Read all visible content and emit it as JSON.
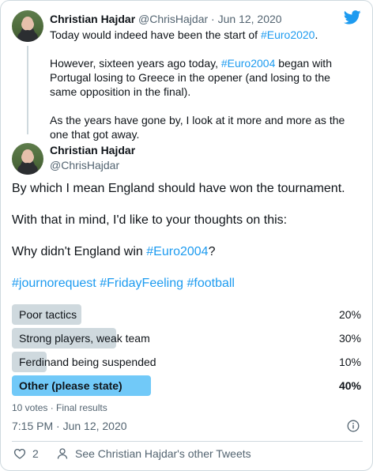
{
  "parent_tweet": {
    "author_name": "Christian Hajdar",
    "handle": "@ChrisHajdar",
    "separator": "·",
    "date": "Jun 12, 2020",
    "line1_prefix": "Today would indeed have been the start of ",
    "line1_hashtag": "#Euro2020",
    "line1_suffix": ".",
    "para2_prefix": "However, sixteen years ago today, ",
    "para2_hashtag": "#Euro2004",
    "para2_suffix": " began with Portugal losing to Greece in the opener (and losing to the same opposition in the final).",
    "para3": "As the years have gone by, I look at it more and more as the one that got away."
  },
  "main_tweet": {
    "author_name": "Christian Hajdar",
    "handle": "@ChrisHajdar",
    "para1": "By which I mean England should have won the tournament.",
    "para2": "With that in mind, I'd like to your thoughts on this:",
    "para3_prefix": "Why didn't England win ",
    "para3_hashtag": "#Euro2004",
    "para3_suffix": "?",
    "hashtags": [
      "#journorequest",
      "#FridayFeeling",
      "#football"
    ]
  },
  "poll": {
    "options": [
      {
        "label": "Poor tactics",
        "percent_text": "20%",
        "percent": 20,
        "winner": false
      },
      {
        "label": "Strong players, weak team",
        "percent_text": "30%",
        "percent": 30,
        "winner": false
      },
      {
        "label": "Ferdinand being suspended",
        "percent_text": "10%",
        "percent": 10,
        "winner": false
      },
      {
        "label": "Other (please state)",
        "percent_text": "40%",
        "percent": 40,
        "winner": true
      }
    ],
    "meta": "10 votes · Final results"
  },
  "timestamp": "7:15 PM · Jun 12, 2020",
  "actions": {
    "like_count": "2",
    "see_more": "See Christian Hajdar's other Tweets"
  },
  "colors": {
    "link": "#1d9bf0",
    "poll_bar": "#cfd9de",
    "poll_winner": "#71c9f8",
    "muted": "#536471"
  },
  "icons": [
    "twitter-bird-icon",
    "info-icon",
    "heart-icon",
    "person-icon"
  ]
}
